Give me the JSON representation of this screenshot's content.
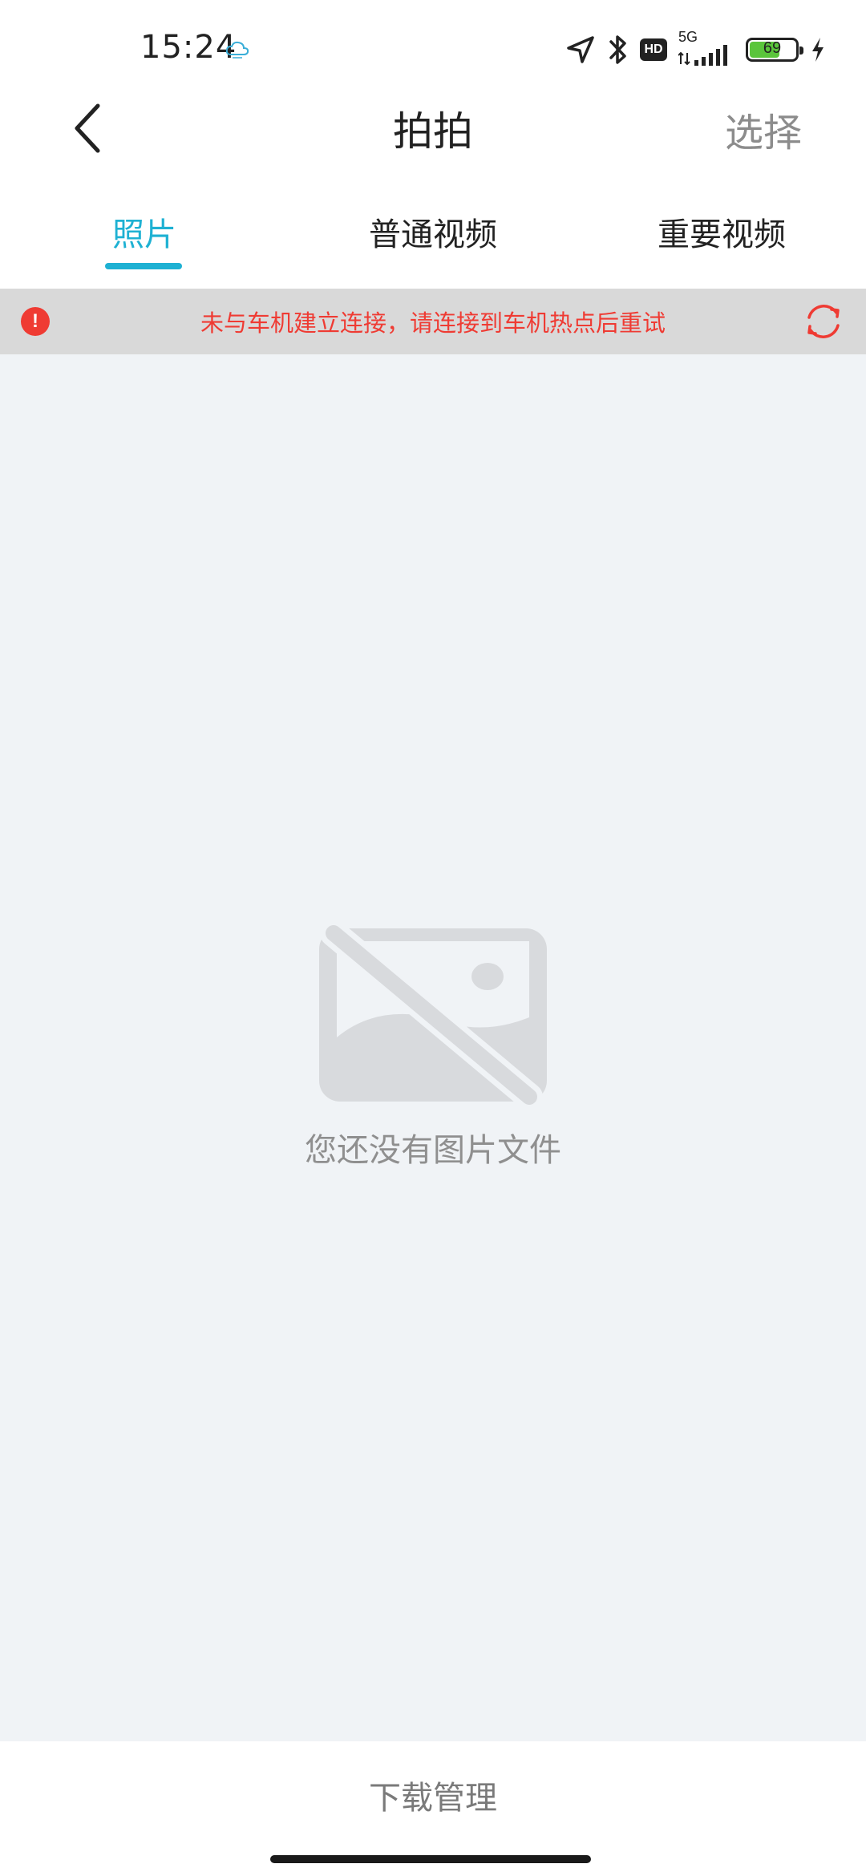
{
  "status_bar": {
    "time": "15:24",
    "network": "5G",
    "hd": "HD",
    "battery": "69",
    "battery_level": 0.69
  },
  "nav": {
    "title": "拍拍",
    "select_label": "选择"
  },
  "tabs": [
    {
      "label": "照片",
      "active": true
    },
    {
      "label": "普通视频",
      "active": false
    },
    {
      "label": "重要视频",
      "active": false
    }
  ],
  "banner": {
    "message": "未与车机建立连接，请连接到车机热点后重试",
    "icon_glyph": "!",
    "color": "#ef3b33"
  },
  "empty_state": {
    "message": "您还没有图片文件"
  },
  "bottom": {
    "download_label": "下载管理"
  },
  "colors": {
    "accent": "#1eb1d3",
    "error": "#ef3b33",
    "content_bg": "#f0f3f6",
    "banner_bg": "#d9d9d9"
  }
}
